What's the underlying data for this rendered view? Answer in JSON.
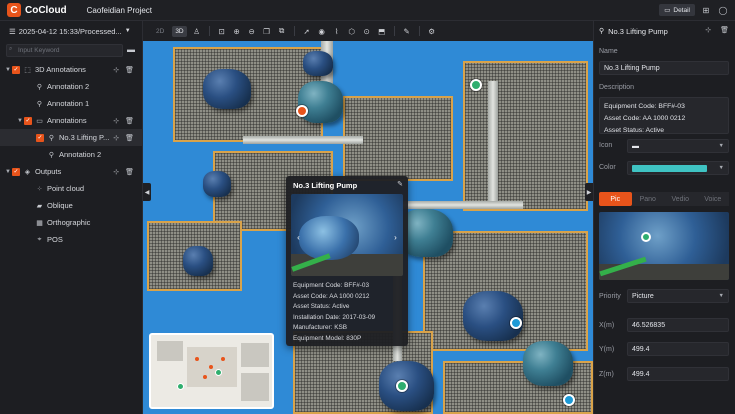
{
  "app": {
    "logo_mark": "C",
    "logo_text": "CoCloud",
    "project_title": "Caofeidian Project"
  },
  "topbar": {
    "detail_label": "Detail"
  },
  "left_panel": {
    "dataset": "2025-04-12 15:33/Processed...",
    "search_placeholder": "Input Keyword",
    "tree": [
      {
        "label": "3D Annotations",
        "level": 0,
        "caret": "▼",
        "checked": true,
        "icon": "cube-icon"
      },
      {
        "label": "Annotation 2",
        "level": 1,
        "caret": "",
        "checked": false,
        "icon": "pin-icon"
      },
      {
        "label": "Annotation 1",
        "level": 1,
        "caret": "",
        "checked": false,
        "icon": "pin-icon"
      },
      {
        "label": "Annotations",
        "level": 1,
        "caret": "▼",
        "checked": true,
        "icon": "folder-icon"
      },
      {
        "label": "No.3 Lifting P...",
        "level": 2,
        "caret": "",
        "checked": true,
        "icon": "pin-icon",
        "selected": true
      },
      {
        "label": "Annotation 2",
        "level": 2,
        "caret": "",
        "checked": false,
        "icon": "pin-icon"
      },
      {
        "label": "Outputs",
        "level": 0,
        "caret": "▼",
        "checked": true,
        "icon": "layers-icon"
      },
      {
        "label": "Point cloud",
        "level": 1,
        "caret": "",
        "checked": false,
        "icon": "point-cloud-icon"
      },
      {
        "label": "Oblique",
        "level": 1,
        "caret": "",
        "checked": false,
        "icon": "oblique-icon"
      },
      {
        "label": "Orthographic",
        "level": 1,
        "caret": "",
        "checked": false,
        "icon": "ortho-icon"
      },
      {
        "label": "POS",
        "level": 1,
        "caret": "",
        "checked": false,
        "icon": "pos-icon"
      }
    ]
  },
  "viewport": {
    "mode_2d": "2D",
    "mode_3d": "3D",
    "active_mode": "3D"
  },
  "popup": {
    "title": "No.3 Lifting Pump",
    "fields": [
      "Equipment Code: BFF#-03",
      "Asset Code: AA 1000 0212",
      "Asset Status: Active",
      "Installation Date: 2017-03-09",
      "Manufacturer: KSB",
      "Equipment Model: 830P"
    ]
  },
  "right_panel": {
    "title": "No.3 Lifting Pump",
    "name_label": "Name",
    "name_value": "No.3 Lifting Pump",
    "description_label": "Description",
    "description_lines": [
      "Equipment Code: BFF#-03",
      "Asset Code: AA 1000 0212",
      "Asset Status: Active"
    ],
    "icon_label": "Icon",
    "color_label": "Color",
    "color_value": "#3fc3c3",
    "tabs": [
      "Pic",
      "Pano",
      "Vedio",
      "Voice"
    ],
    "active_tab": "Pic",
    "priority_label": "Priority",
    "priority_value": "Picture",
    "x_label": "X(m)",
    "x_value": "46.526835",
    "y_label": "Y(m)",
    "y_value": "499.4",
    "z_label": "Z(m)",
    "z_value": "499.4"
  },
  "colors": {
    "accent": "#e8541b",
    "panel": "#1d1e22",
    "floor_blue": "#2f8ad6"
  }
}
